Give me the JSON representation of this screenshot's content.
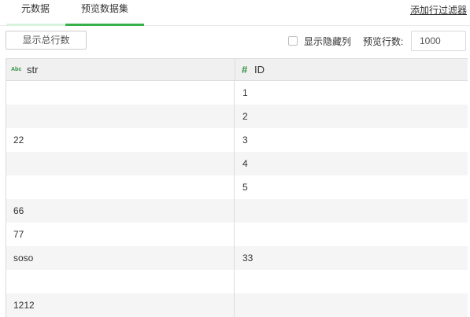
{
  "tabs": [
    {
      "label": "元数据"
    },
    {
      "label": "预览数据集"
    }
  ],
  "filter_link": "添加行过滤器",
  "toolbar": {
    "show_total_label": "显示总行数",
    "show_hidden_label": "显示隐藏列",
    "preview_rows_label": "预览行数:",
    "preview_rows_value": "1000"
  },
  "table": {
    "columns": [
      {
        "type_icon": "Abc",
        "name": "str"
      },
      {
        "type_icon": "#",
        "name": "ID"
      }
    ],
    "rows": [
      {
        "str": "",
        "id": "1"
      },
      {
        "str": "",
        "id": "2"
      },
      {
        "str": "22",
        "id": "3"
      },
      {
        "str": "",
        "id": "4"
      },
      {
        "str": "",
        "id": "5"
      },
      {
        "str": "66",
        "id": ""
      },
      {
        "str": "77",
        "id": ""
      },
      {
        "str": "soso",
        "id": "33"
      },
      {
        "str": "",
        "id": ""
      },
      {
        "str": "1212",
        "id": ""
      }
    ]
  },
  "colors": {
    "accent": "#38b04a",
    "type_icon": "#2f8f3a"
  }
}
